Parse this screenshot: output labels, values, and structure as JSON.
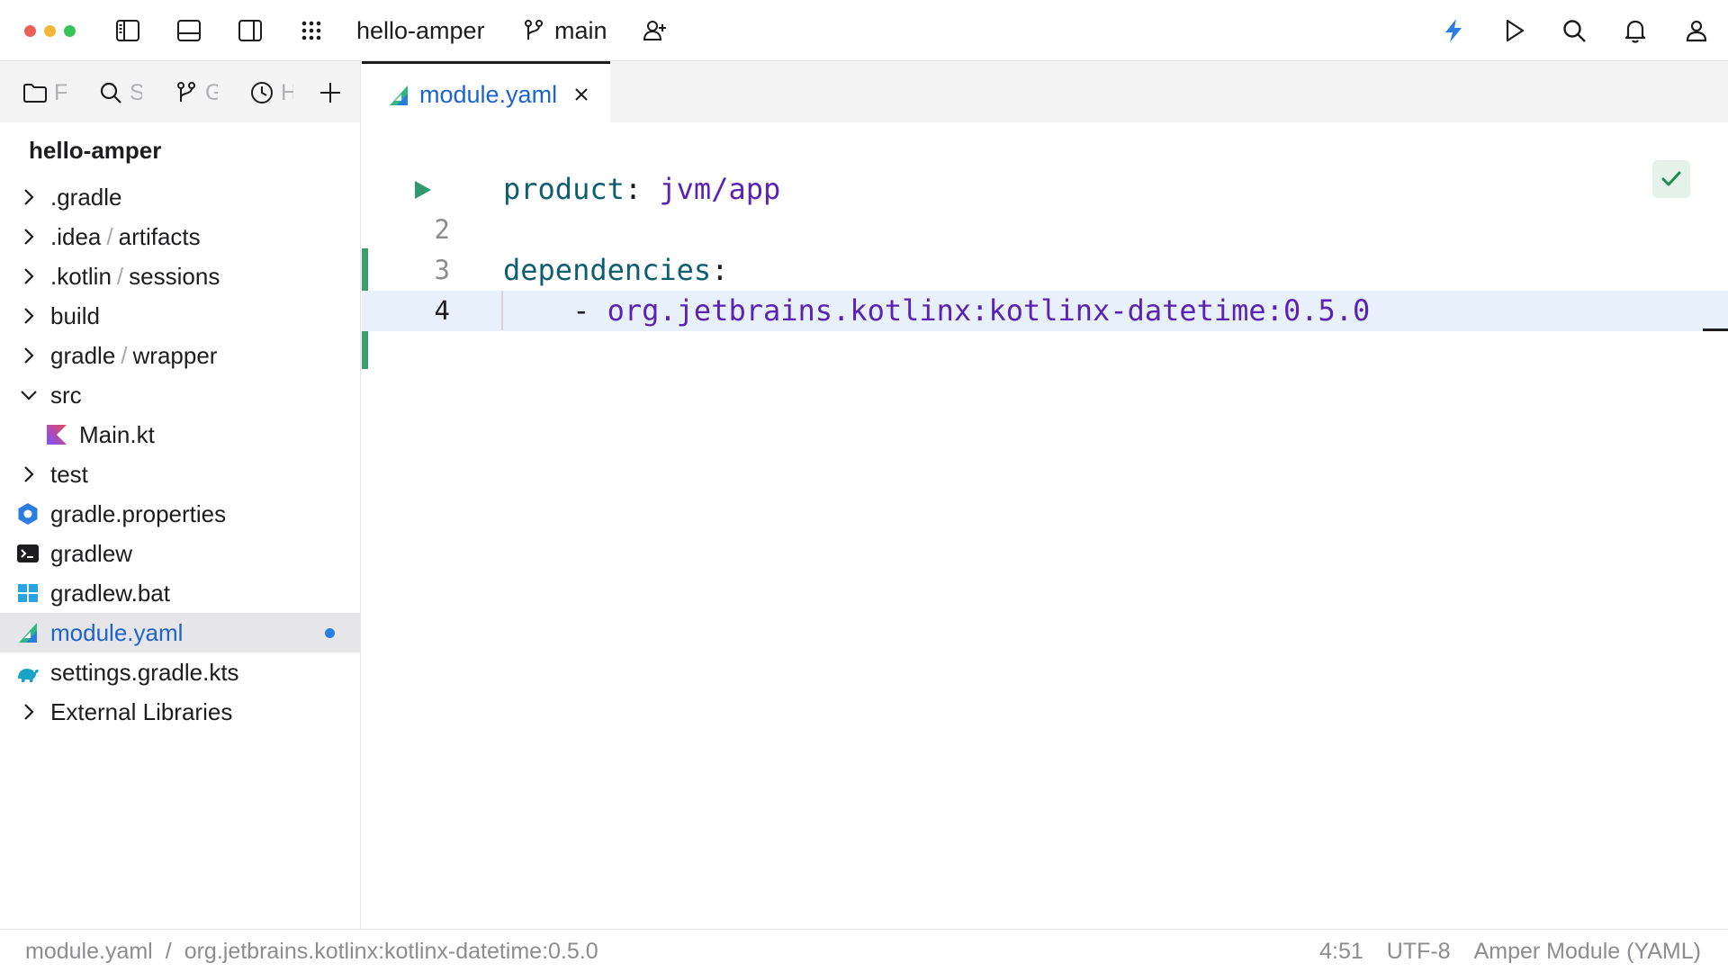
{
  "window": {
    "project_name": "hello-amper",
    "branch": "main"
  },
  "sidebar": {
    "tabs": [
      {
        "icon": "folder-icon",
        "label": "F"
      },
      {
        "icon": "search-icon",
        "label": "S"
      },
      {
        "icon": "branch-icon",
        "label": "G"
      },
      {
        "icon": "clock-icon",
        "label": "H"
      }
    ],
    "project_title": "hello-amper",
    "tree": [
      {
        "name": ".gradle",
        "sub": "",
        "chevron": "right"
      },
      {
        "name": ".idea",
        "sub": "artifacts",
        "chevron": "right"
      },
      {
        "name": ".kotlin",
        "sub": "sessions",
        "chevron": "right"
      },
      {
        "name": "build",
        "sub": "",
        "chevron": "right"
      },
      {
        "name": "gradle",
        "sub": "wrapper",
        "chevron": "right"
      },
      {
        "name": "src",
        "sub": "",
        "chevron": "down"
      },
      {
        "name": "Main.kt",
        "icon": "kotlin-icon"
      },
      {
        "name": "test",
        "sub": "",
        "chevron": "right"
      },
      {
        "name": "gradle.properties",
        "icon": "properties-icon"
      },
      {
        "name": "gradlew",
        "icon": "terminal-icon"
      },
      {
        "name": "gradlew.bat",
        "icon": "windows-icon"
      },
      {
        "name": "module.yaml",
        "icon": "amper-icon",
        "selected": true,
        "modified": true
      },
      {
        "name": "settings.gradle.kts",
        "icon": "gradle-elephant-icon"
      },
      {
        "name": "External Libraries",
        "sub": "",
        "chevron": "right"
      }
    ]
  },
  "editor": {
    "tab": {
      "label": "module.yaml"
    },
    "lines": [
      {
        "num": "",
        "key": "product",
        "colon": ":",
        "value": " jvm/app"
      },
      {
        "num": "2"
      },
      {
        "num": "3",
        "key": "dependencies",
        "colon": ":"
      },
      {
        "num": "4",
        "dash": "    - ",
        "value": "org.jetbrains.kotlinx:kotlinx-datetime:0.5.0",
        "current": true
      }
    ]
  },
  "statusbar": {
    "file": "module.yaml",
    "separator": "/",
    "path": "org.jetbrains.kotlinx:kotlinx-datetime:0.5.0",
    "position": "4:51",
    "encoding": "UTF-8",
    "file_type": "Amper Module (YAML)"
  },
  "colors": {
    "accent": "#1d63cc",
    "yaml_key": "#0e5e6f",
    "yaml_value": "#5a23b3",
    "vcs_added": "#3c9e6e"
  }
}
